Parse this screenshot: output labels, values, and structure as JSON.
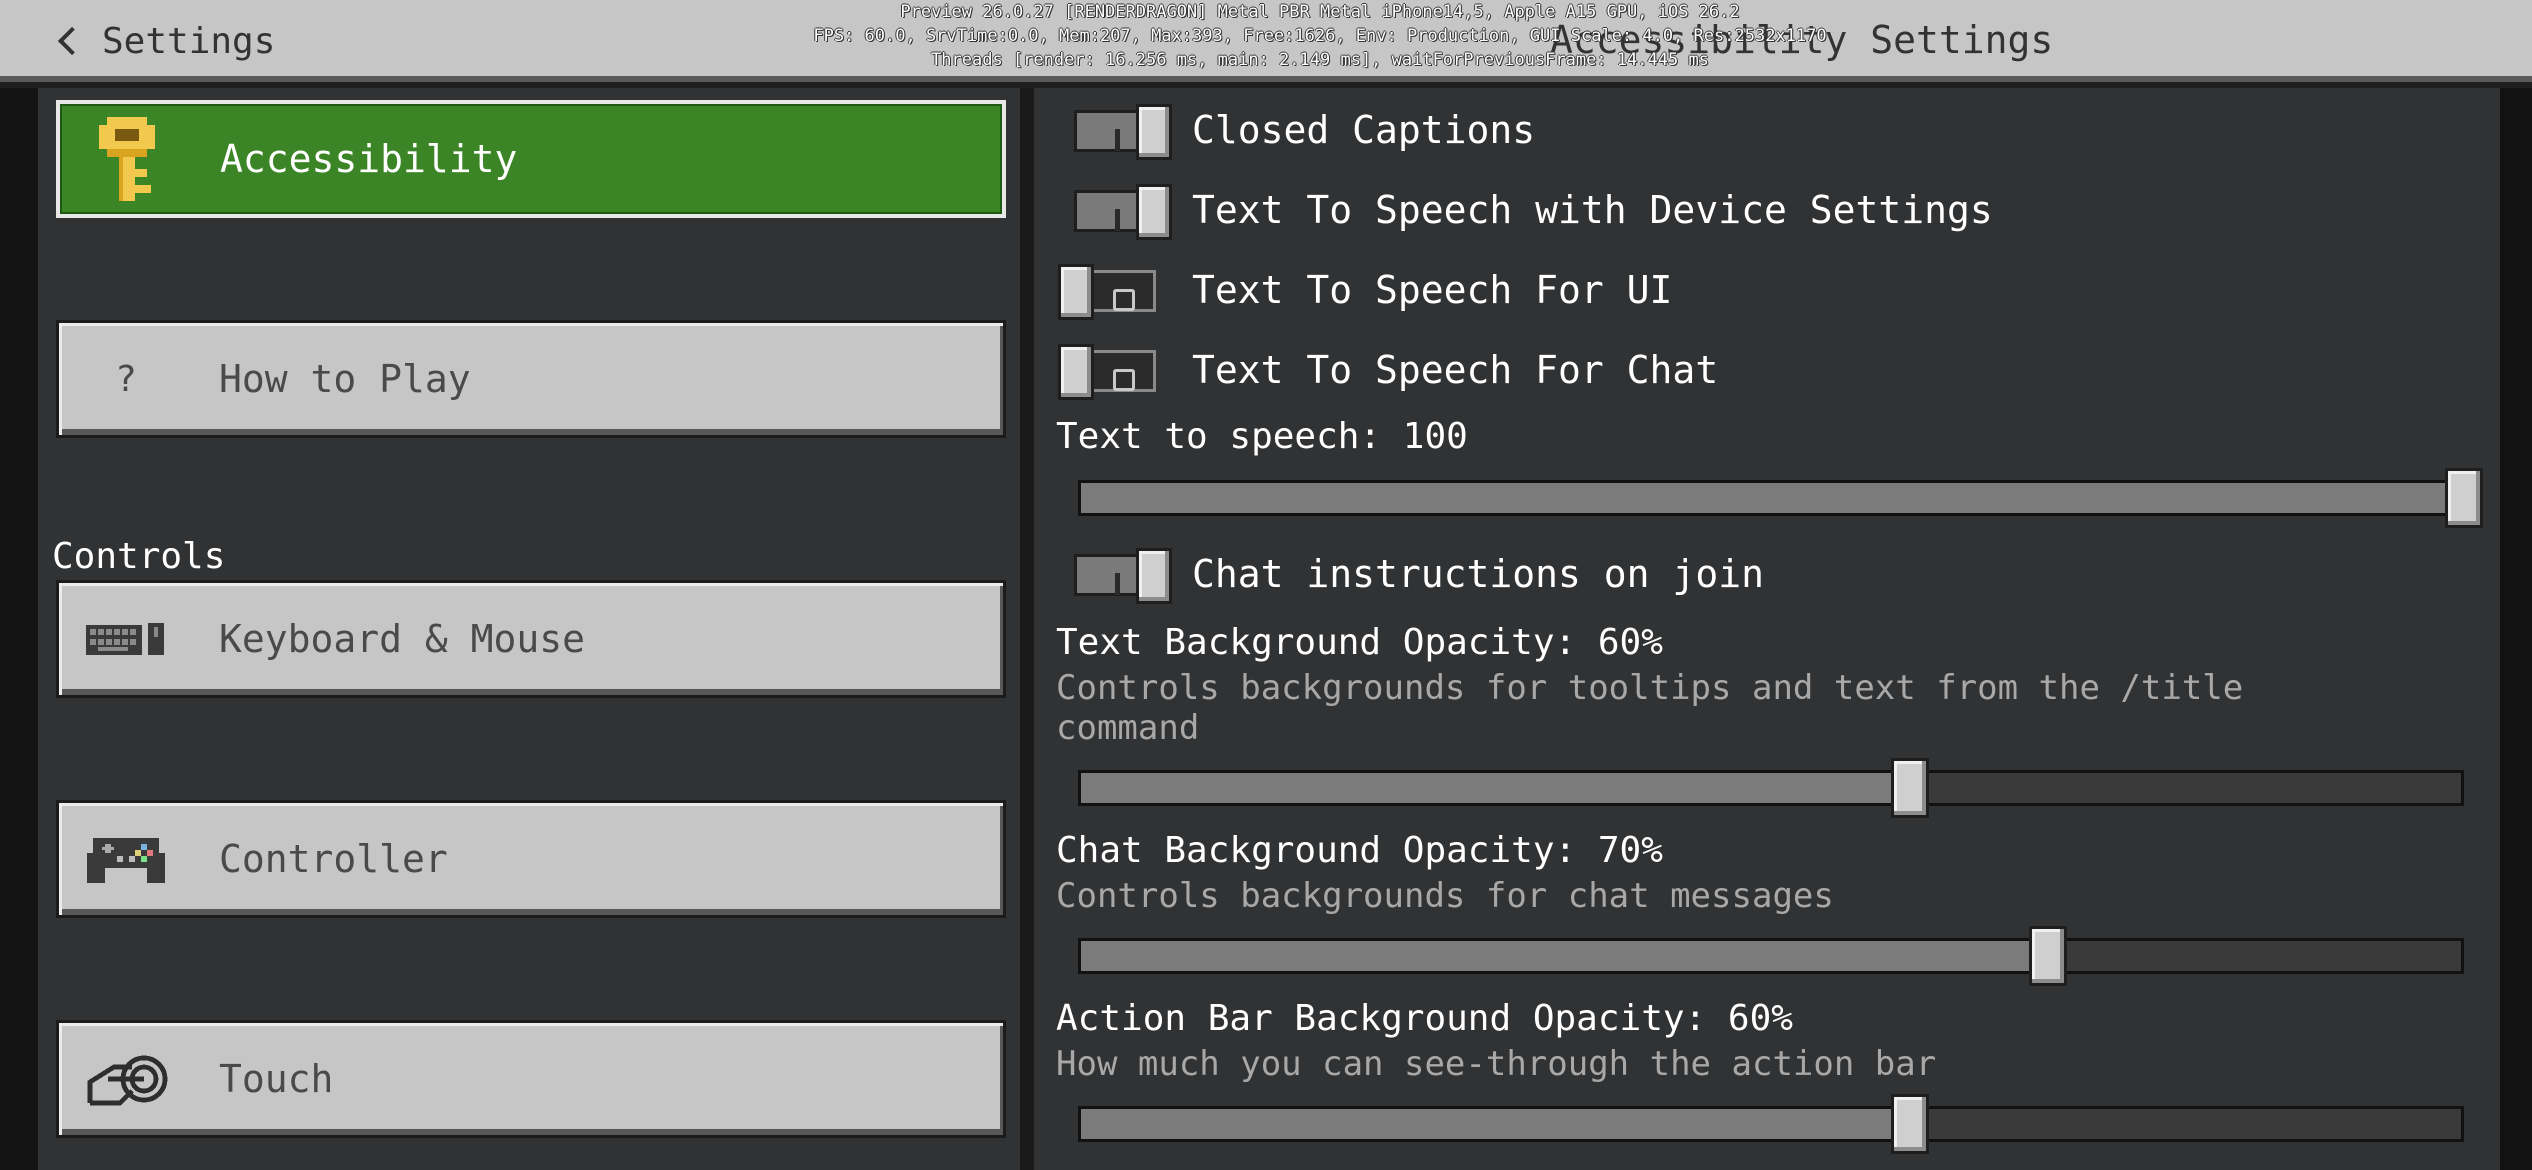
{
  "header": {
    "back_label": "Settings",
    "title": "Accessibility Settings",
    "debug_lines": [
      "Preview 26.0.27 [RENDERDRAGON] Metal PBR Metal iPhone14,5, Apple A15 GPU, iOS 26.2",
      "FPS: 60.0, SrvTime:0.0, Mem:207, Max:393, Free:1626, Env: Production, GUI Scale: 4.0, Res:2532x1170",
      "Threads [render: 16.256 ms, main: 2.149 ms], waitForPreviousFrame: 14.445 ms"
    ]
  },
  "sidebar": {
    "items": [
      {
        "label": "Accessibility",
        "icon": "key-icon",
        "active": true
      },
      {
        "label": "How to Play",
        "icon": "question-icon",
        "active": false
      }
    ],
    "section_controls": "Controls",
    "controls_items": [
      {
        "label": "Keyboard & Mouse",
        "icon": "keyboard-mouse-icon"
      },
      {
        "label": "Controller",
        "icon": "controller-icon"
      },
      {
        "label": "Touch",
        "icon": "touch-icon"
      }
    ]
  },
  "settings": {
    "toggles": [
      {
        "label": "Closed Captions",
        "on": true
      },
      {
        "label": "Text To Speech with Device Settings",
        "on": true
      },
      {
        "label": "Text To Speech For UI",
        "on": false
      },
      {
        "label": "Text To Speech For Chat",
        "on": false
      }
    ],
    "tts_heading": "Text to speech: 100",
    "tts_value": 100,
    "chat_instructions": {
      "label": "Chat instructions on join",
      "on": true
    },
    "text_bg": {
      "heading": "Text Background Opacity: 60%",
      "desc": "Controls backgrounds for tooltips and text from the /title command",
      "value": 60
    },
    "chat_bg": {
      "heading": "Chat Background Opacity: 70%",
      "desc": "Controls backgrounds for chat messages",
      "value": 70
    },
    "action_bar_bg": {
      "heading": "Action Bar Background Opacity: 60%",
      "desc": "How much you can see-through the action bar",
      "value": 60
    }
  }
}
